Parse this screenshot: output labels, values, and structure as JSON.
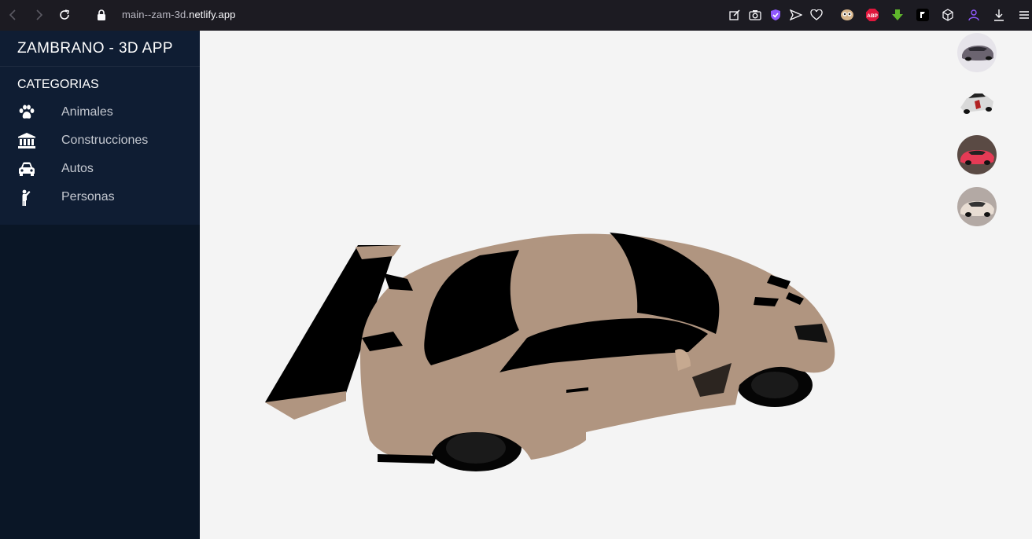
{
  "browser": {
    "url_prefix": "main--zam-3d.",
    "url_domain": "netlify.app",
    "icons": [
      "back-icon",
      "forward-icon",
      "reload-icon",
      "lock-icon",
      "edit-icon",
      "camera-icon",
      "shield-icon",
      "send-icon",
      "heart-icon",
      "extension-owl-icon",
      "adblock-icon",
      "download-arrow-icon",
      "extension-f-icon",
      "cube-icon",
      "account-icon",
      "download-icon",
      "menu-icon"
    ],
    "adblock_label": "ABP"
  },
  "sidebar": {
    "brand": "ZAMBRANO - 3D APP",
    "category_title": "CATEGORIAS",
    "items": [
      {
        "label": "Animales",
        "icon": "paw-icon"
      },
      {
        "label": "Construcciones",
        "icon": "building-icon"
      },
      {
        "label": "Autos",
        "icon": "car-icon"
      },
      {
        "label": "Personas",
        "icon": "person-icon"
      }
    ]
  },
  "viewer": {
    "model": "3d-car-model",
    "thumbnails": [
      {
        "name": "grey-sports-car"
      },
      {
        "name": "race-car"
      },
      {
        "name": "red-sports-car"
      },
      {
        "name": "beige-sports-car"
      }
    ]
  },
  "colors": {
    "sidebar_bg": "#0a1626",
    "menu_bg": "#0f1d33",
    "viewer_bg": "#f4f4f4",
    "car_body": "#b09580"
  }
}
